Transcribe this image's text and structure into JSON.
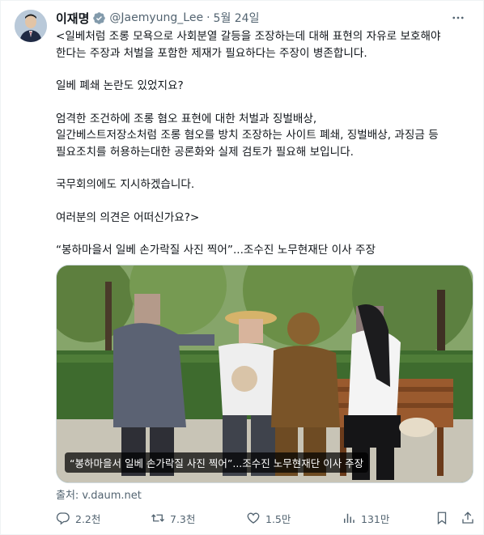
{
  "tweet": {
    "author_name": "이재명",
    "handle": "@Jaemyung_Lee",
    "separator": "·",
    "date": "5월 24일",
    "paragraphs": [
      "<일베처럼 조롱 모욕으로 사회분열 갈등을 조장하는데 대해 표현의 자유로 보호해야\n한다는 주장과 처벌을 포함한 제재가 필요하다는 주장이 병존합니다.",
      "일베 폐쇄 논란도 있었지요?",
      "엄격한 조건하에 조롱 혐오 표현에 대한 처벌과 징벌배상,\n일간베스트저장소처럼 조롱 혐오를 방치 조장하는 사이트 폐쇄, 징벌배상, 과징금 등\n필요조치를 허용하는대한 공론화와 실제 검토가 필요해 보입니다.",
      "국무회의에도 지시하겠습니다.",
      "여러분의 의견은 어떠신가요?>",
      "“봉하마을서 일베 손가락질 사진 찍어”...조수진 노무현재단 이사 주장"
    ],
    "media_caption": "“봉하마을서 일베 손가락질 사진 찍어”...조수진 노무현재단 이사 주장",
    "source": "출처: v.daum.net"
  },
  "actions": {
    "replies": "2.2천",
    "retweets": "7.3천",
    "likes": "1.5만",
    "views": "131만"
  },
  "icons": [
    "avatar",
    "verified-badge-icon",
    "more-icon",
    "reply-icon",
    "retweet-icon",
    "like-icon",
    "views-icon",
    "bookmark-icon",
    "share-icon"
  ],
  "colors": {
    "text": "#0f1419",
    "secondary": "#536471",
    "verified": "#1d9bf0",
    "border": "#cfd9de"
  }
}
